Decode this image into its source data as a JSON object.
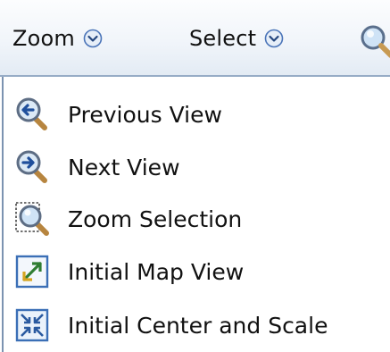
{
  "toolbar": {
    "zoom_label": "Zoom",
    "select_label": "Select",
    "zoom_chevron_icon": "chevron-circle-down-icon",
    "select_chevron_icon": "chevron-circle-down-icon",
    "magnifier_icon": "magnifier-icon"
  },
  "menu": {
    "items": [
      {
        "label": "Previous View",
        "icon": "magnifier-back-arrow-icon"
      },
      {
        "label": "Next View",
        "icon": "magnifier-forward-arrow-icon"
      },
      {
        "label": "Zoom Selection",
        "icon": "zoom-selection-icon"
      },
      {
        "label": "Initial Map View",
        "icon": "expand-diagonal-icon"
      },
      {
        "label": "Initial Center and Scale",
        "icon": "center-scale-icon"
      }
    ]
  },
  "colors": {
    "toolbar_border": "#97acc6",
    "icon_blue": "#3b6fb6",
    "chevron_blue": "#4a74b8"
  }
}
